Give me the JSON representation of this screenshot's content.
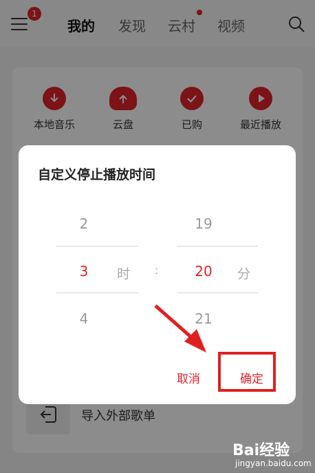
{
  "header": {
    "menu_badge": "1",
    "tabs": [
      {
        "label": "我的"
      },
      {
        "label": "发现"
      },
      {
        "label": "云村"
      },
      {
        "label": "视频"
      }
    ]
  },
  "quick_actions": [
    {
      "label": "本地音乐",
      "icon": "download-icon"
    },
    {
      "label": "云盘",
      "icon": "cloud-upload-icon"
    },
    {
      "label": "已购",
      "icon": "check-icon"
    },
    {
      "label": "最近播放",
      "icon": "play-icon"
    }
  ],
  "import_row": {
    "label": "导入外部歌单",
    "icon": "import-icon"
  },
  "dialog": {
    "title": "自定义停止播放时间",
    "hours": {
      "prev": "2",
      "selected": "3",
      "next": "4",
      "unit": "时"
    },
    "separator": ":",
    "minutes": {
      "prev": "19",
      "selected": "20",
      "next": "21",
      "unit": "分"
    },
    "cancel_label": "取消",
    "confirm_label": "确定"
  },
  "watermark": {
    "brand": "Bai经验",
    "url": "jingyan.baidu.com"
  },
  "colors": {
    "accent": "#e0242a",
    "annotation": "#e02020"
  }
}
